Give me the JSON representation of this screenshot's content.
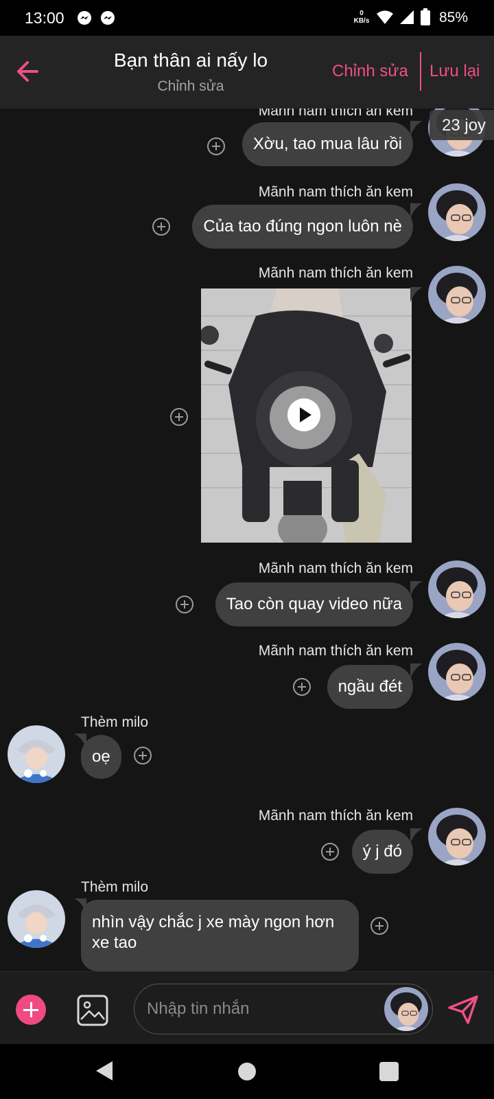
{
  "status_bar": {
    "time": "13:00",
    "net_speed_value": "0",
    "net_speed_unit": "KB/s",
    "battery": "85%",
    "icons": [
      "messenger-icon",
      "messenger-icon",
      "wifi-icon",
      "signal-icon",
      "battery-icon"
    ]
  },
  "header": {
    "title": "Bạn thân ai nấy lo",
    "subtitle": "Chỉnh sửa",
    "edit_label": "Chỉnh sửa",
    "save_label": "Lưu lại",
    "accent_color": "#ef4f86"
  },
  "messages": [
    {
      "side": "right",
      "sender": "Mãnh nam thích ăn kem",
      "type": "text",
      "text": "Xờu, tao mua lâu rồi"
    },
    {
      "side": "right",
      "sender": "Mãnh nam thích ăn kem",
      "type": "text",
      "text": "Của tao đúng ngon luôn nè"
    },
    {
      "side": "right",
      "sender": "Mãnh nam thích ăn kem",
      "type": "video"
    },
    {
      "side": "right",
      "sender": "Mãnh nam thích ăn kem",
      "type": "text",
      "text": "Tao còn quay video nữa"
    },
    {
      "side": "right",
      "sender": "Mãnh nam thích ăn kem",
      "type": "text",
      "text": "ngầu đét"
    },
    {
      "side": "left",
      "sender": "Thèm milo",
      "type": "text",
      "text": "oẹ"
    },
    {
      "side": "right",
      "sender": "Mãnh nam thích ăn kem",
      "type": "text",
      "text": "ý j đó"
    },
    {
      "side": "left",
      "sender": "Thèm milo",
      "type": "text",
      "text": "nhìn vậy chắc j xe mày ngon hơn xe tao"
    }
  ],
  "overlay_badge": "23 joy",
  "composer": {
    "placeholder": "Nhập tin nhắn",
    "plus_color": "#f04a83",
    "send_color": "#ef4f86"
  },
  "nav": {
    "icons": [
      "back-triangle-icon",
      "home-circle-icon",
      "recents-square-icon"
    ]
  }
}
